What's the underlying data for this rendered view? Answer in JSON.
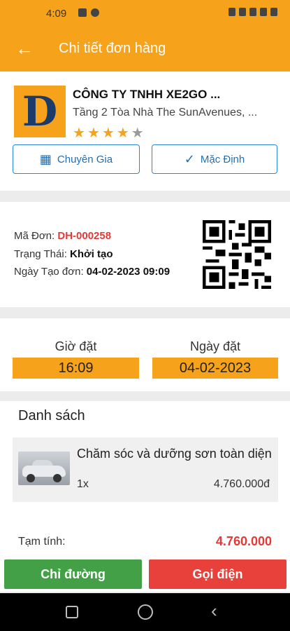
{
  "status": {
    "time": "4:09"
  },
  "header": {
    "title": "Chi tiết đơn hàng",
    "back_icon": "back-arrow-icon"
  },
  "shop": {
    "name": "CÔNG TY TNHH XE2GO ...",
    "address": "Tầng 2 Tòa Nhà The SunAvenues, ...",
    "rating": 4.5,
    "stars": [
      "★",
      "★",
      "★",
      "★",
      "★"
    ],
    "buttons": {
      "expert": "Chuyên Gia",
      "default": "Mặc Định"
    }
  },
  "order": {
    "code_label": "Mã Đơn:",
    "code": "DH-000258",
    "status_label": "Trạng Thái:",
    "status": "Khởi tạo",
    "created_label": "Ngày Tạo đơn:",
    "created": "04-02-2023 09:09"
  },
  "booking": {
    "time_label": "Giờ đặt",
    "time": "16:09",
    "date_label": "Ngày đặt",
    "date": "04-02-2023"
  },
  "list": {
    "title": "Danh sách",
    "items": [
      {
        "name": "Chăm sóc và dưỡng sơn toàn diện",
        "qty": "1x",
        "price": "4.760.000đ"
      }
    ],
    "subtotal_label": "Tạm tính:",
    "subtotal": "4.760.000"
  },
  "actions": {
    "directions": "Chỉ đường",
    "call": "Gọi điện"
  },
  "colors": {
    "accent": "#f7a21b",
    "green": "#43a047",
    "red": "#e8403a",
    "link": "#2a86d6"
  }
}
